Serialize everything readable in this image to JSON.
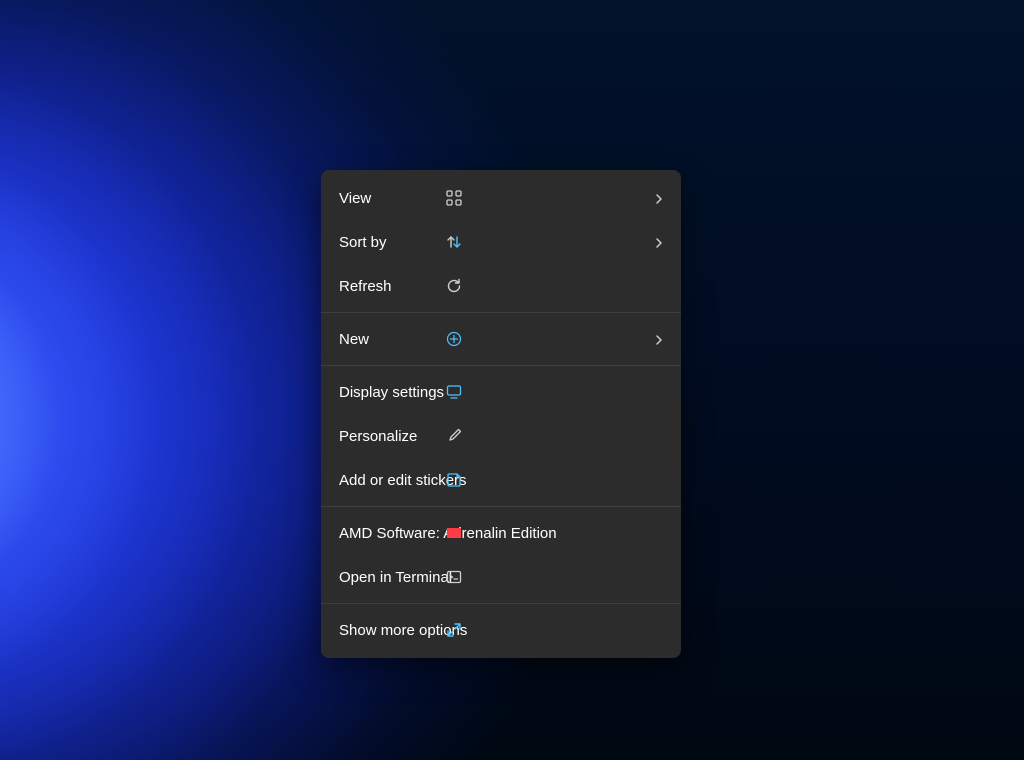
{
  "context_menu": {
    "items": [
      {
        "id": "view",
        "label": "View",
        "icon": "grid-icon",
        "has_submenu": true
      },
      {
        "id": "sort-by",
        "label": "Sort by",
        "icon": "sort-icon",
        "has_submenu": true
      },
      {
        "id": "refresh",
        "label": "Refresh",
        "icon": "refresh-icon",
        "has_submenu": false
      },
      {
        "separator": true
      },
      {
        "id": "new",
        "label": "New",
        "icon": "plus-icon",
        "has_submenu": true
      },
      {
        "separator": true
      },
      {
        "id": "display-settings",
        "label": "Display settings",
        "icon": "monitor-icon",
        "has_submenu": false
      },
      {
        "id": "personalize",
        "label": "Personalize",
        "icon": "brush-icon",
        "has_submenu": false
      },
      {
        "id": "stickers",
        "label": "Add or edit stickers",
        "icon": "sticker-icon",
        "has_submenu": false
      },
      {
        "separator": true
      },
      {
        "id": "amd-software",
        "label": "AMD Software: Adrenalin Edition",
        "icon": "amd-icon",
        "has_submenu": false
      },
      {
        "id": "open-terminal",
        "label": "Open in Terminal",
        "icon": "terminal-icon",
        "has_submenu": false
      },
      {
        "separator": true
      },
      {
        "id": "show-more",
        "label": "Show more options",
        "icon": "expand-icon",
        "has_submenu": false
      }
    ]
  },
  "colors": {
    "menu_bg": "#2c2c2c",
    "accent_blue": "#4cc2ff",
    "amd_red": "#ff3b47"
  }
}
